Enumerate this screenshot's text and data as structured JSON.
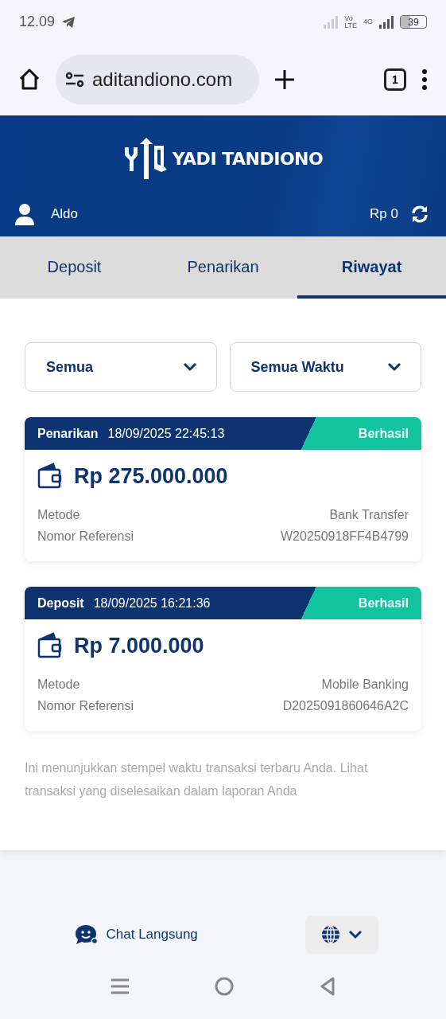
{
  "status_bar": {
    "time": "12.09",
    "volte_top": "Vo",
    "volte_bottom": "LTE",
    "network": "4G",
    "battery": "39"
  },
  "browser": {
    "url": "aditandiono.com",
    "tab_count": "1"
  },
  "header": {
    "brand": "YADI TANDIONO",
    "user": "Aldo",
    "balance": "Rp 0"
  },
  "tabs": [
    {
      "label": "Deposit",
      "selected": false
    },
    {
      "label": "Penarikan",
      "selected": false
    },
    {
      "label": "Riwayat",
      "selected": true
    }
  ],
  "filters": [
    {
      "value": "Semua"
    },
    {
      "value": "Semua Waktu"
    }
  ],
  "transactions": [
    {
      "type": "Penarikan",
      "datetime": "18/09/2025 22:45:13",
      "status": "Berhasil",
      "amount": "Rp 275.000.000",
      "rows": [
        {
          "label": "Metode",
          "value": "Bank Transfer"
        },
        {
          "label": "Nomor Referensi",
          "value": "W20250918FF4B4799"
        }
      ]
    },
    {
      "type": "Deposit",
      "datetime": "18/09/2025 16:21:36",
      "status": "Berhasil",
      "amount": "Rp 7.000.000",
      "rows": [
        {
          "label": "Metode",
          "value": "Mobile Banking"
        },
        {
          "label": "Nomor Referensi",
          "value": "D2025091860646A2C"
        }
      ]
    }
  ],
  "note": "Ini menunjukkan stempel waktu transaksi terbaru Anda. Lihat transaksi yang diselesaikan dalam laporan Anda",
  "footer": {
    "chat": "Chat Langsung"
  }
}
